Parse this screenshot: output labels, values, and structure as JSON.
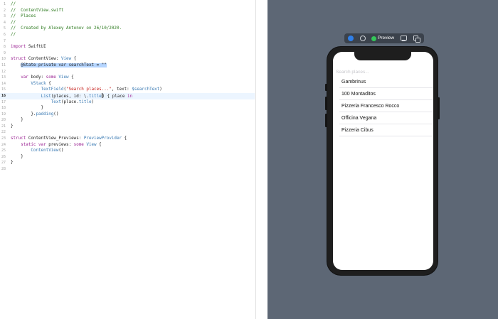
{
  "editor": {
    "lines": [
      {
        "n": "1",
        "tokens": [
          {
            "c": "c",
            "t": "//"
          }
        ]
      },
      {
        "n": "2",
        "tokens": [
          {
            "c": "c",
            "t": "//  ContentView.swift"
          }
        ]
      },
      {
        "n": "3",
        "tokens": [
          {
            "c": "c",
            "t": "//  Places"
          }
        ]
      },
      {
        "n": "4",
        "tokens": [
          {
            "c": "c",
            "t": "//"
          }
        ]
      },
      {
        "n": "5",
        "tokens": [
          {
            "c": "c",
            "t": "//  Created by Alexey Antonov on 26/10/2020."
          }
        ]
      },
      {
        "n": "6",
        "tokens": [
          {
            "c": "c",
            "t": "//"
          }
        ]
      },
      {
        "n": "7",
        "tokens": []
      },
      {
        "n": "8",
        "tokens": [
          {
            "c": "k",
            "t": "import"
          },
          {
            "c": "n",
            "t": " SwiftUI"
          }
        ]
      },
      {
        "n": "9",
        "tokens": []
      },
      {
        "n": "10",
        "tokens": [
          {
            "c": "k",
            "t": "struct"
          },
          {
            "c": "n",
            "t": " ContentView: "
          },
          {
            "c": "t",
            "t": "View"
          },
          {
            "c": "n",
            "t": " {"
          }
        ]
      },
      {
        "n": "11",
        "tokens": [
          {
            "c": "n",
            "t": "    "
          },
          {
            "c": "sel",
            "t": "@State private var searchText = \"\""
          }
        ]
      },
      {
        "n": "12",
        "tokens": []
      },
      {
        "n": "13",
        "tokens": [
          {
            "c": "n",
            "t": "    "
          },
          {
            "c": "k",
            "t": "var"
          },
          {
            "c": "n",
            "t": " body: "
          },
          {
            "c": "k",
            "t": "some"
          },
          {
            "c": "n",
            "t": " "
          },
          {
            "c": "t",
            "t": "View"
          },
          {
            "c": "n",
            "t": " {"
          }
        ]
      },
      {
        "n": "14",
        "tokens": [
          {
            "c": "n",
            "t": "        "
          },
          {
            "c": "f",
            "t": "VStack"
          },
          {
            "c": "n",
            "t": " {"
          }
        ]
      },
      {
        "n": "15",
        "tokens": [
          {
            "c": "n",
            "t": "            "
          },
          {
            "c": "f",
            "t": "TextField"
          },
          {
            "c": "n",
            "t": "("
          },
          {
            "c": "s",
            "t": "\"Search places...\""
          },
          {
            "c": "n",
            "t": ", text: "
          },
          {
            "c": "f",
            "t": "$searchText"
          },
          {
            "c": "n",
            "t": ")"
          }
        ]
      },
      {
        "n": "16",
        "current": true,
        "tokens": [
          {
            "c": "n",
            "t": "            "
          },
          {
            "c": "f",
            "t": "List"
          },
          {
            "c": "n",
            "t": "(places, id: \\."
          },
          {
            "c": "f",
            "t": "title"
          },
          {
            "c": "caret",
            "t": ""
          },
          {
            "c": "n",
            "t": ") { place "
          },
          {
            "c": "k",
            "t": "in"
          }
        ]
      },
      {
        "n": "17",
        "tokens": [
          {
            "c": "n",
            "t": "                "
          },
          {
            "c": "f",
            "t": "Text"
          },
          {
            "c": "n",
            "t": "(place."
          },
          {
            "c": "f",
            "t": "title"
          },
          {
            "c": "n",
            "t": ")"
          }
        ]
      },
      {
        "n": "18",
        "tokens": [
          {
            "c": "n",
            "t": "            }"
          }
        ]
      },
      {
        "n": "19",
        "tokens": [
          {
            "c": "n",
            "t": "        }."
          },
          {
            "c": "f",
            "t": "padding"
          },
          {
            "c": "n",
            "t": "()"
          }
        ]
      },
      {
        "n": "20",
        "tokens": [
          {
            "c": "n",
            "t": "    }"
          }
        ]
      },
      {
        "n": "21",
        "tokens": [
          {
            "c": "n",
            "t": "}"
          }
        ]
      },
      {
        "n": "22",
        "tokens": []
      },
      {
        "n": "23",
        "tokens": [
          {
            "c": "k",
            "t": "struct"
          },
          {
            "c": "n",
            "t": " ContentView_Previews: "
          },
          {
            "c": "t",
            "t": "PreviewProvider"
          },
          {
            "c": "n",
            "t": " {"
          }
        ]
      },
      {
        "n": "24",
        "tokens": [
          {
            "c": "n",
            "t": "    "
          },
          {
            "c": "k",
            "t": "static var"
          },
          {
            "c": "n",
            "t": " previews: "
          },
          {
            "c": "k",
            "t": "some"
          },
          {
            "c": "n",
            "t": " "
          },
          {
            "c": "t",
            "t": "View"
          },
          {
            "c": "n",
            "t": " {"
          }
        ]
      },
      {
        "n": "25",
        "tokens": [
          {
            "c": "n",
            "t": "        "
          },
          {
            "c": "f",
            "t": "ContentView"
          },
          {
            "c": "n",
            "t": "()"
          }
        ]
      },
      {
        "n": "26",
        "tokens": [
          {
            "c": "n",
            "t": "    }"
          }
        ]
      },
      {
        "n": "27",
        "tokens": [
          {
            "c": "n",
            "t": "}"
          }
        ]
      },
      {
        "n": "28",
        "tokens": []
      }
    ]
  },
  "canvas": {
    "background": "#5d6775",
    "toolbar": {
      "live_icon": "live-preview-icon",
      "inspect_icon": "inspect-icon",
      "preview_label": "Preview",
      "device_icon": "device-settings-icon",
      "duplicate_icon": "duplicate-preview-icon"
    },
    "app": {
      "search_placeholder": "Search places...",
      "places": [
        "Gambrinus",
        "100 Montaditos",
        "Pizzeria Francesco Rocco",
        "Officina Vegana",
        "Pizzeria Cibus"
      ]
    }
  }
}
